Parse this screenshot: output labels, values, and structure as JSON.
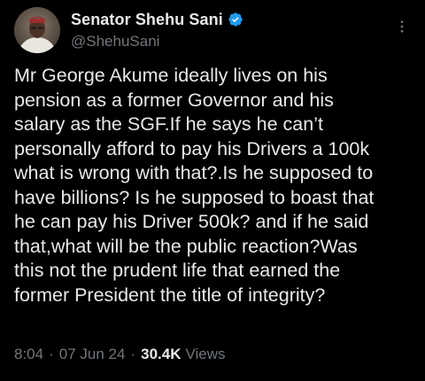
{
  "author": {
    "display_name": "Senator Shehu Sani",
    "handle": "@ShehuSani",
    "verified_color": "#1d9bf0",
    "avatar_icon": "user-avatar"
  },
  "tweet": {
    "lines": [
      "Mr George Akume ideally lives on his",
      "pension as a former Governor and his",
      "salary as the SGF.If he says he can’t",
      "personally afford to pay his Drivers a 100k",
      "what is wrong with that?.Is he supposed to",
      "have billions? Is he supposed to boast that",
      "he can pay his Driver 500k? and if he said",
      "that,what will be the public reaction?Was",
      "this not the prudent life that earned the",
      "former President the title of integrity?"
    ]
  },
  "meta": {
    "time": "8:04",
    "separator": "·",
    "date": "07 Jun 24",
    "views_count": "30.4K",
    "views_label": "Views"
  },
  "colors": {
    "background": "#000000",
    "text_primary": "#e7e9ea",
    "text_secondary": "#71767b",
    "verified_blue": "#1d9bf0"
  }
}
